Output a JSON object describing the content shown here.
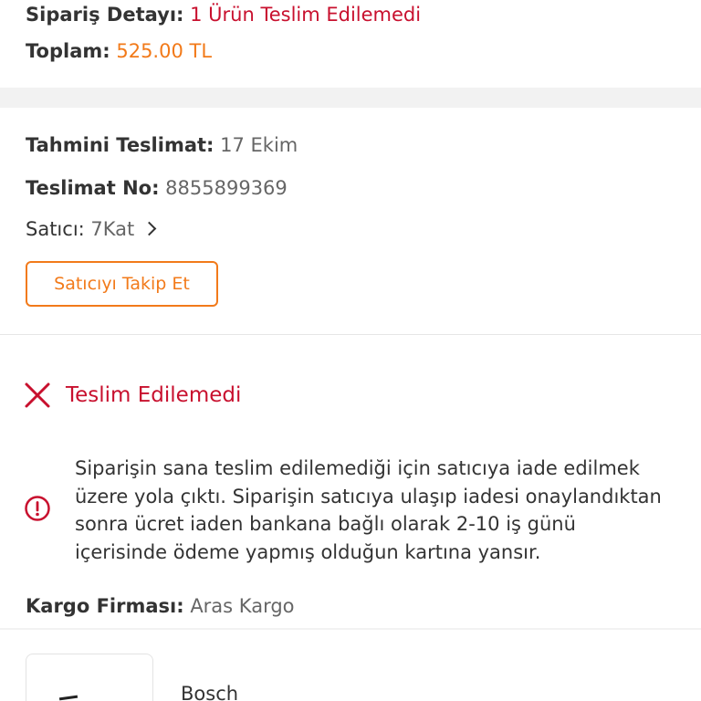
{
  "order": {
    "detail_label": "Sipariş Detayı:",
    "detail_value": "1 Ürün Teslim Edilemedi",
    "total_label": "Toplam:",
    "total_value": "525.00 TL"
  },
  "delivery": {
    "estimate_label": "Tahmini Teslimat:",
    "estimate_value": "17 Ekim",
    "number_label": "Teslimat No:",
    "number_value": "8855899369",
    "seller_label": "Satıcı:",
    "seller_value": "7Kat",
    "follow_button": "Satıcıyı Takip Et"
  },
  "status": {
    "title": "Teslim Edilemedi",
    "info_lines": [
      "Siparişin sana teslim edilemediği için satıcıya iade edilmek",
      "üzere yola çıktı. Siparişin satıcıya ulaşıp iadesi onaylandıktan",
      "sonra ücret iaden bankana bağlı olarak 2-10 iş günü",
      "içerisinde ödeme yapmış olduğun kartına yansır."
    ],
    "cargo_label": "Kargo Firması:",
    "cargo_value": "Aras Kargo"
  },
  "product": {
    "brand": "Bosch"
  },
  "icons": {
    "status": "close-x-icon",
    "info": "info-circle-icon",
    "seller_link": "chevron-right-icon"
  },
  "colors": {
    "accent_orange": "#f27a1a",
    "error_red": "#c8102e",
    "text_dark": "#333333",
    "text_gray": "#666666",
    "separator": "#f2f2f2"
  }
}
